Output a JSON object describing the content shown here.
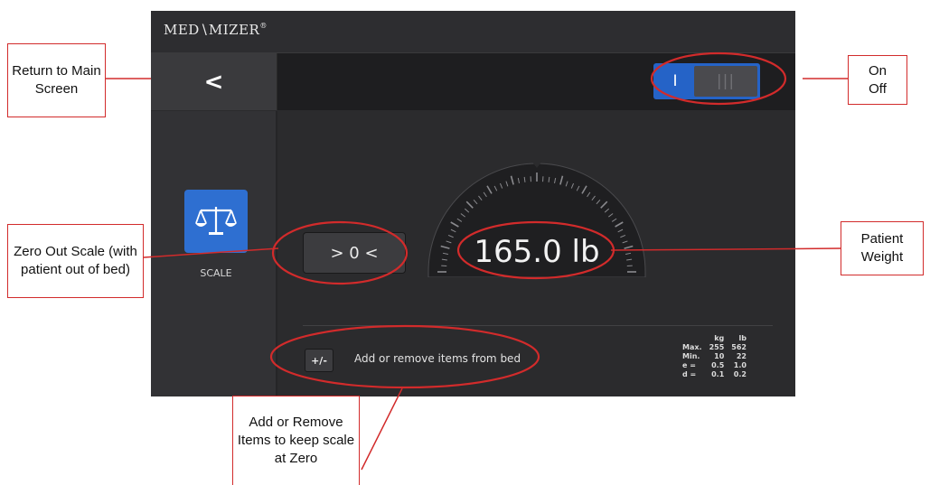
{
  "app": {
    "logo_text": "MED∖MIZER",
    "logo_tm": "®"
  },
  "header": {
    "back_glyph": "<",
    "toggle_on_label": "I",
    "toggle_off_label": "|||"
  },
  "sidebar": {
    "scale_icon": "scale-icon",
    "scale_label": "SCALE"
  },
  "main": {
    "zero_button_label": "> 0 <",
    "weight_display": "165.0 lb",
    "plus_minus_label": "+/-",
    "plus_minus_text": "Add or remove items from bed"
  },
  "specs": {
    "headers": [
      "kg",
      "lb"
    ],
    "rows": [
      {
        "label": "Max.",
        "kg": "255",
        "lb": "562"
      },
      {
        "label": "Min.",
        "kg": "10",
        "lb": "22"
      },
      {
        "label": "e =",
        "kg": "0.5",
        "lb": "1.0"
      },
      {
        "label": "d =",
        "kg": "0.1",
        "lb": "0.2"
      }
    ]
  },
  "annotations": {
    "return_main": "Return to Main Screen",
    "on_off_line1": "On",
    "on_off_line2": "Off",
    "zero_out": "Zero Out Scale (with patient out of bed)",
    "patient_weight": "Patient Weight",
    "add_remove": "Add or Remove Items to keep scale at Zero"
  },
  "colors": {
    "accent_blue": "#2563c7",
    "annotation_red": "#d22b2b",
    "screen_bg": "#2b2b2d"
  }
}
